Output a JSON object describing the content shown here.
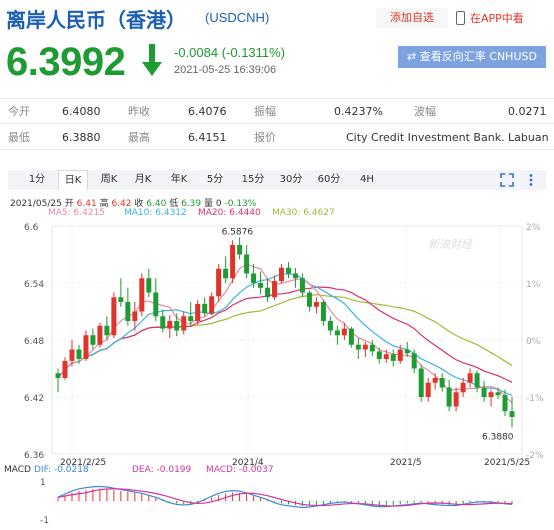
{
  "header": {
    "title": "离岸人民币（香港）",
    "code": "(USDCNH)",
    "add_fav": "添加自选",
    "app_link": "在APP中看"
  },
  "quote": {
    "price": "6.3992",
    "change": "-0.0084 (-0.1311%)",
    "time": "2021-05-25 16:39:06",
    "reverse_button": "查看反向汇率 CNHUSD"
  },
  "stats": {
    "open_label": "今开",
    "open": "6.4080",
    "prev_close_label": "昨收",
    "prev_close": "6.4076",
    "amplitude_label": "振幅",
    "amplitude": "0.4237%",
    "wave_label": "波幅",
    "wave": "0.0271",
    "low_label": "最低",
    "low": "6.3880",
    "high_label": "最高",
    "high": "6.4151",
    "quote_label": "报价",
    "quoter": "City Credit Investment Bank. Labuan"
  },
  "tabs": [
    "1分",
    "日K",
    "周K",
    "月K",
    "年K",
    "5分",
    "15分",
    "30分",
    "60分",
    "4H"
  ],
  "active_tab": 1,
  "info_line": {
    "date": "2021/05/25",
    "open_lbl": "开",
    "open": "6.41",
    "high_lbl": "高",
    "high": "6.42",
    "close_lbl": "收",
    "close": "6.40",
    "low_lbl": "低",
    "low": "6.39",
    "vol_lbl": "量",
    "vol": "0",
    "pct": "-0.13%"
  },
  "ma_labels": {
    "ma5": "MA5: 6.4215",
    "ma10": "MA10: 6.4312",
    "ma20": "MA20: 6.4440",
    "ma30": "MA30: 6.4627"
  },
  "macd_labels": {
    "title": "MACD",
    "dif": "DIF: -0.0218",
    "dea": "DEA: -0.0199",
    "macd": "MACD: -0.0037"
  },
  "colors": {
    "up": "#e0332a",
    "down": "#1e9b33",
    "ma5": "#e889a5",
    "ma10": "#3ab4e0",
    "ma20": "#d6336c",
    "ma30": "#a5b83a",
    "dif": "#3a8ad6",
    "dea": "#d6339d"
  },
  "chart_data": [
    {
      "type": "candlestick",
      "title": "",
      "y_ticks": [
        "6.6",
        "6.54",
        "6.48",
        "6.42",
        "6.36"
      ],
      "right_ticks": [
        "2%",
        "1%",
        "0%",
        "-1%",
        "-2%"
      ],
      "x_ticks": [
        "2021/2/25",
        "2021/4",
        "2021/5",
        "2021/5/25"
      ],
      "ylim": [
        6.36,
        6.6
      ],
      "grid": true,
      "watermark": "新浪财经",
      "annotations": {
        "max": "6.5876",
        "min": "6.3880"
      },
      "candles": [
        [
          6.445,
          6.45,
          6.425,
          6.44
        ],
        [
          6.44,
          6.462,
          6.438,
          6.458
        ],
        [
          6.458,
          6.48,
          6.452,
          6.47
        ],
        [
          6.47,
          6.475,
          6.455,
          6.46
        ],
        [
          6.46,
          6.49,
          6.458,
          6.485
        ],
        [
          6.485,
          6.492,
          6.47,
          6.475
        ],
        [
          6.475,
          6.498,
          6.472,
          6.495
        ],
        [
          6.495,
          6.505,
          6.48,
          6.485
        ],
        [
          6.485,
          6.53,
          6.482,
          6.525
        ],
        [
          6.525,
          6.545,
          6.515,
          6.52
        ],
        [
          6.52,
          6.535,
          6.495,
          6.5
        ],
        [
          6.5,
          6.52,
          6.49,
          6.51
        ],
        [
          6.51,
          6.55,
          6.505,
          6.545
        ],
        [
          6.545,
          6.555,
          6.525,
          6.53
        ],
        [
          6.53,
          6.545,
          6.5,
          6.505
        ],
        [
          6.505,
          6.512,
          6.488,
          6.492
        ],
        [
          6.492,
          6.506,
          6.482,
          6.5
        ],
        [
          6.5,
          6.508,
          6.484,
          6.49
        ],
        [
          6.49,
          6.51,
          6.486,
          6.505
        ],
        [
          6.505,
          6.52,
          6.495,
          6.5
        ],
        [
          6.5,
          6.522,
          6.496,
          6.518
        ],
        [
          6.518,
          6.525,
          6.505,
          6.508
        ],
        [
          6.508,
          6.53,
          6.506,
          6.526
        ],
        [
          6.526,
          6.56,
          6.52,
          6.555
        ],
        [
          6.555,
          6.568,
          6.54,
          6.545
        ],
        [
          6.545,
          6.585,
          6.54,
          6.58
        ],
        [
          6.58,
          6.588,
          6.565,
          6.57
        ],
        [
          6.57,
          6.58,
          6.545,
          6.55
        ],
        [
          6.55,
          6.56,
          6.535,
          6.54
        ],
        [
          6.54,
          6.552,
          6.528,
          6.535
        ],
        [
          6.535,
          6.545,
          6.52,
          6.525
        ],
        [
          6.525,
          6.548,
          6.522,
          6.542
        ],
        [
          6.542,
          6.56,
          6.54,
          6.556
        ],
        [
          6.556,
          6.562,
          6.545,
          6.55
        ],
        [
          6.55,
          6.556,
          6.535,
          6.545
        ],
        [
          6.545,
          6.55,
          6.525,
          6.53
        ],
        [
          6.53,
          6.532,
          6.51,
          6.515
        ],
        [
          6.515,
          6.525,
          6.508,
          6.52
        ],
        [
          6.52,
          6.522,
          6.495,
          6.5
        ],
        [
          6.5,
          6.505,
          6.485,
          6.49
        ],
        [
          6.49,
          6.495,
          6.475,
          6.485
        ],
        [
          6.485,
          6.498,
          6.48,
          6.492
        ],
        [
          6.492,
          6.494,
          6.472,
          6.475
        ],
        [
          6.475,
          6.482,
          6.46,
          6.47
        ],
        [
          6.47,
          6.478,
          6.462,
          6.475
        ],
        [
          6.475,
          6.48,
          6.463,
          6.468
        ],
        [
          6.468,
          6.472,
          6.455,
          6.46
        ],
        [
          6.46,
          6.47,
          6.456,
          6.465
        ],
        [
          6.465,
          6.47,
          6.452,
          6.458
        ],
        [
          6.458,
          6.475,
          6.455,
          6.47
        ],
        [
          6.47,
          6.478,
          6.462,
          6.466
        ],
        [
          6.466,
          6.47,
          6.445,
          6.45
        ],
        [
          6.45,
          6.454,
          6.415,
          6.42
        ],
        [
          6.42,
          6.44,
          6.415,
          6.435
        ],
        [
          6.435,
          6.445,
          6.428,
          6.44
        ],
        [
          6.44,
          6.445,
          6.425,
          6.43
        ],
        [
          6.43,
          6.438,
          6.405,
          6.41
        ],
        [
          6.41,
          6.43,
          6.405,
          6.425
        ],
        [
          6.425,
          6.44,
          6.42,
          6.435
        ],
        [
          6.435,
          6.45,
          6.43,
          6.445
        ],
        [
          6.445,
          6.448,
          6.425,
          6.43
        ],
        [
          6.43,
          6.437,
          6.415,
          6.42
        ],
        [
          6.42,
          6.428,
          6.41,
          6.425
        ],
        [
          6.425,
          6.43,
          6.418,
          6.422
        ],
        [
          6.422,
          6.428,
          6.4,
          6.405
        ],
        [
          6.405,
          6.42,
          6.388,
          6.399
        ]
      ]
    },
    {
      "type": "bar",
      "title": "MACD",
      "y_ticks": [
        "1",
        "-1"
      ],
      "values": [
        0.2,
        0.35,
        0.5,
        0.6,
        0.65,
        0.7,
        0.72,
        0.7,
        0.65,
        0.6,
        0.55,
        0.5,
        0.45,
        0.35,
        0.25,
        0.1,
        -0.05,
        -0.15,
        -0.2,
        -0.18,
        -0.1,
        0.05,
        0.2,
        0.35,
        0.45,
        0.5,
        0.48,
        0.4,
        0.3,
        0.2,
        0.1,
        -0.05,
        -0.15,
        -0.2,
        -0.25,
        -0.3,
        -0.28,
        -0.25,
        -0.2,
        -0.15,
        -0.12,
        -0.1,
        -0.15,
        -0.2,
        -0.25,
        -0.3,
        -0.32,
        -0.3,
        -0.25,
        -0.2,
        -0.15,
        -0.1,
        -0.05,
        -0.1,
        -0.15,
        -0.2,
        -0.22,
        -0.25,
        -0.2,
        -0.15,
        -0.1,
        -0.1,
        -0.12,
        -0.15,
        -0.18,
        -0.2
      ]
    }
  ]
}
